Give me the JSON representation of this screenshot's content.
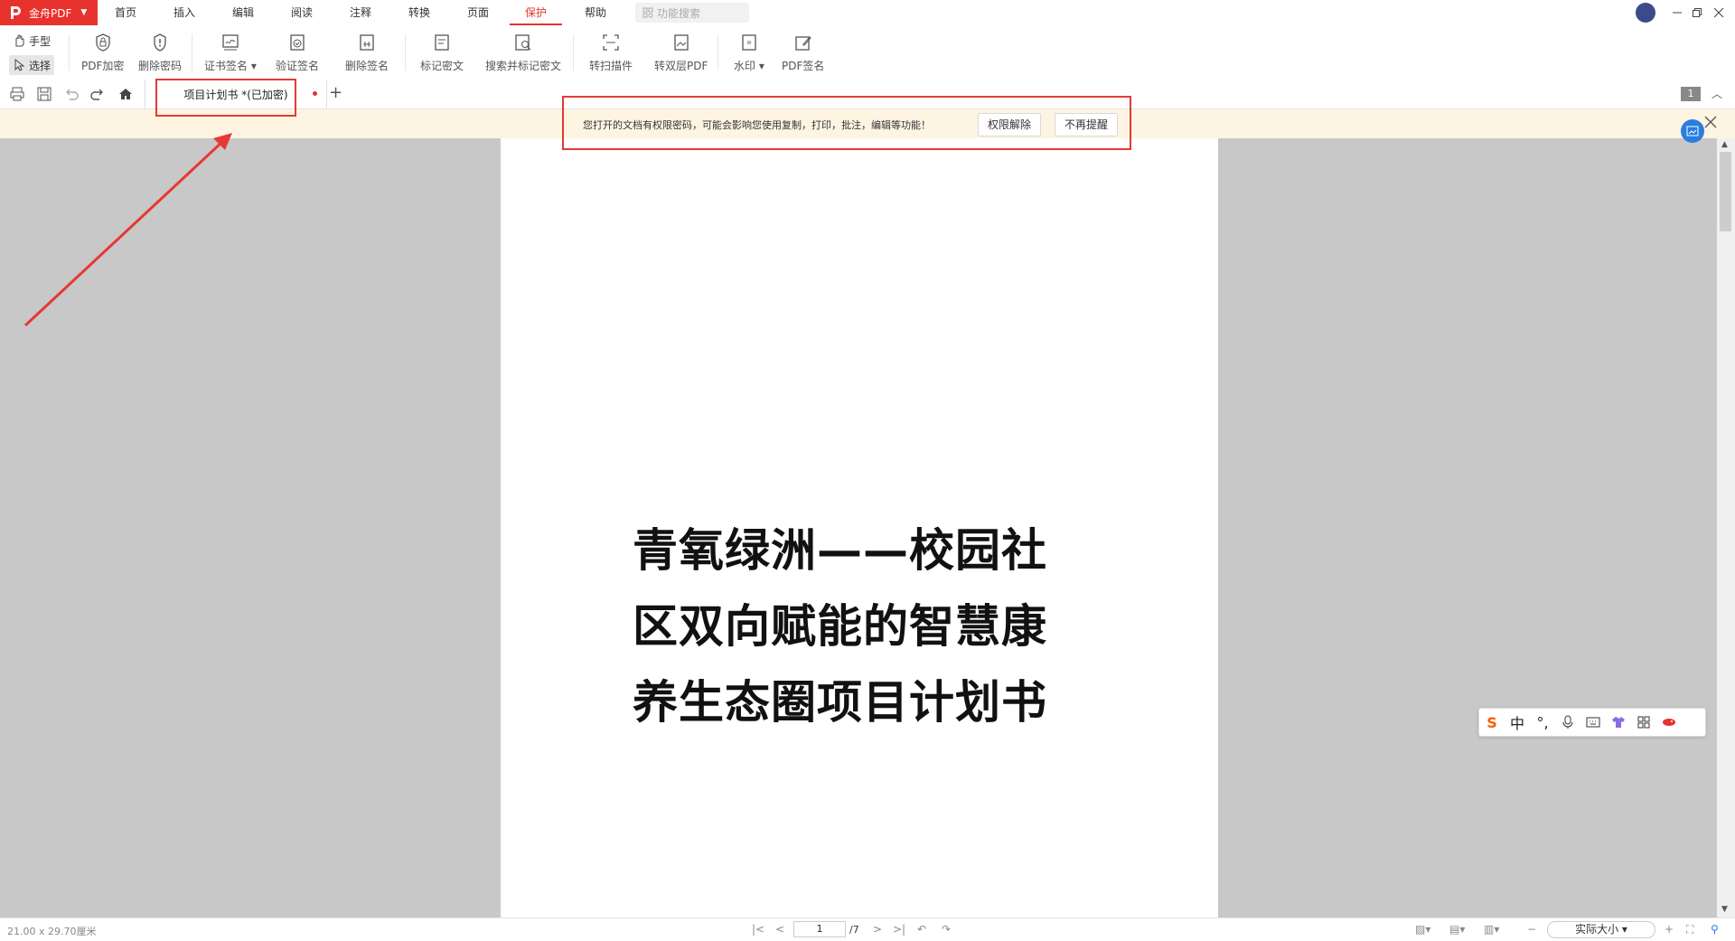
{
  "app": {
    "name": "金舟PDF"
  },
  "menu": {
    "items": [
      "首页",
      "插入",
      "编辑",
      "阅读",
      "注释",
      "转换",
      "页面",
      "保护",
      "帮助"
    ],
    "active": "保护",
    "search_placeholder": "功能搜索"
  },
  "modes": {
    "hand": "手型",
    "select": "选择"
  },
  "ribbon": {
    "tools": [
      {
        "label": "PDF加密",
        "icon": "lock-shield-icon"
      },
      {
        "label": "删除密码",
        "icon": "unlock-icon"
      },
      {
        "label": "证书签名",
        "icon": "certificate-sign-icon"
      },
      {
        "label": "验证签名",
        "icon": "verify-sign-icon"
      },
      {
        "label": "删除签名",
        "icon": "delete-sign-icon"
      },
      {
        "label": "标记密文",
        "icon": "mark-redaction-icon"
      },
      {
        "label": "搜索并标记密文",
        "icon": "search-redaction-icon"
      },
      {
        "label": "转扫描件",
        "icon": "scan-convert-icon"
      },
      {
        "label": "转双层PDF",
        "icon": "double-layer-icon"
      },
      {
        "label": "水印",
        "icon": "watermark-icon"
      },
      {
        "label": "PDF签名",
        "icon": "pdf-sign-icon"
      }
    ]
  },
  "tabs": {
    "document": "项目计划书 *(已加密)",
    "page_count_badge": "1"
  },
  "notice": {
    "text": "您打开的文档有权限密码，可能会影响您使用复制，打印，批注，编辑等功能！",
    "button_remove": "权限解除",
    "button_dismiss": "不再提醒"
  },
  "document": {
    "title_lines": [
      "青氧绿洲——校园社",
      "区双向赋能的智慧康",
      "养生态圈项目计划书"
    ]
  },
  "ime": {
    "mode_label": "中"
  },
  "status": {
    "page_size": "21.00 x 29.70厘米",
    "current_page": "1",
    "total_pages": "/7",
    "zoom": "实际大小"
  },
  "colors": {
    "brand": "#e8322d",
    "notice_bg": "#fdf4e2",
    "annotation": "#e53935",
    "badge_blue": "#2a7de1"
  }
}
